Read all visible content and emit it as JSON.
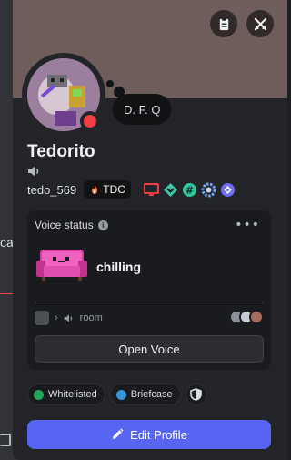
{
  "background": {
    "partial_text": "ca"
  },
  "profile": {
    "display_name": "Tedorito",
    "username": "tedo_569",
    "custom_status": "D. F. Q",
    "presence_color": "#f23f43",
    "banner_color": "#6e5d5a",
    "guild_tag": {
      "emoji_icon": "fire-icon",
      "label": "TDC"
    },
    "badges": [
      "monitor-badge-icon",
      "hypesquad-badge-icon",
      "hashtag-badge-icon",
      "gear-badge-icon",
      "quest-badge-icon"
    ]
  },
  "voice_status": {
    "header": "Voice status",
    "activity_label": "chilling",
    "channel_name": "room"
  },
  "buttons": {
    "open_voice": "Open Voice",
    "edit_profile": "Edit Profile"
  },
  "roles": [
    {
      "label": "Whitelisted",
      "color": "#23a55a"
    },
    {
      "label": "Briefcase",
      "color": "#3498db"
    }
  ],
  "colors": {
    "accent": "#5865f2"
  }
}
